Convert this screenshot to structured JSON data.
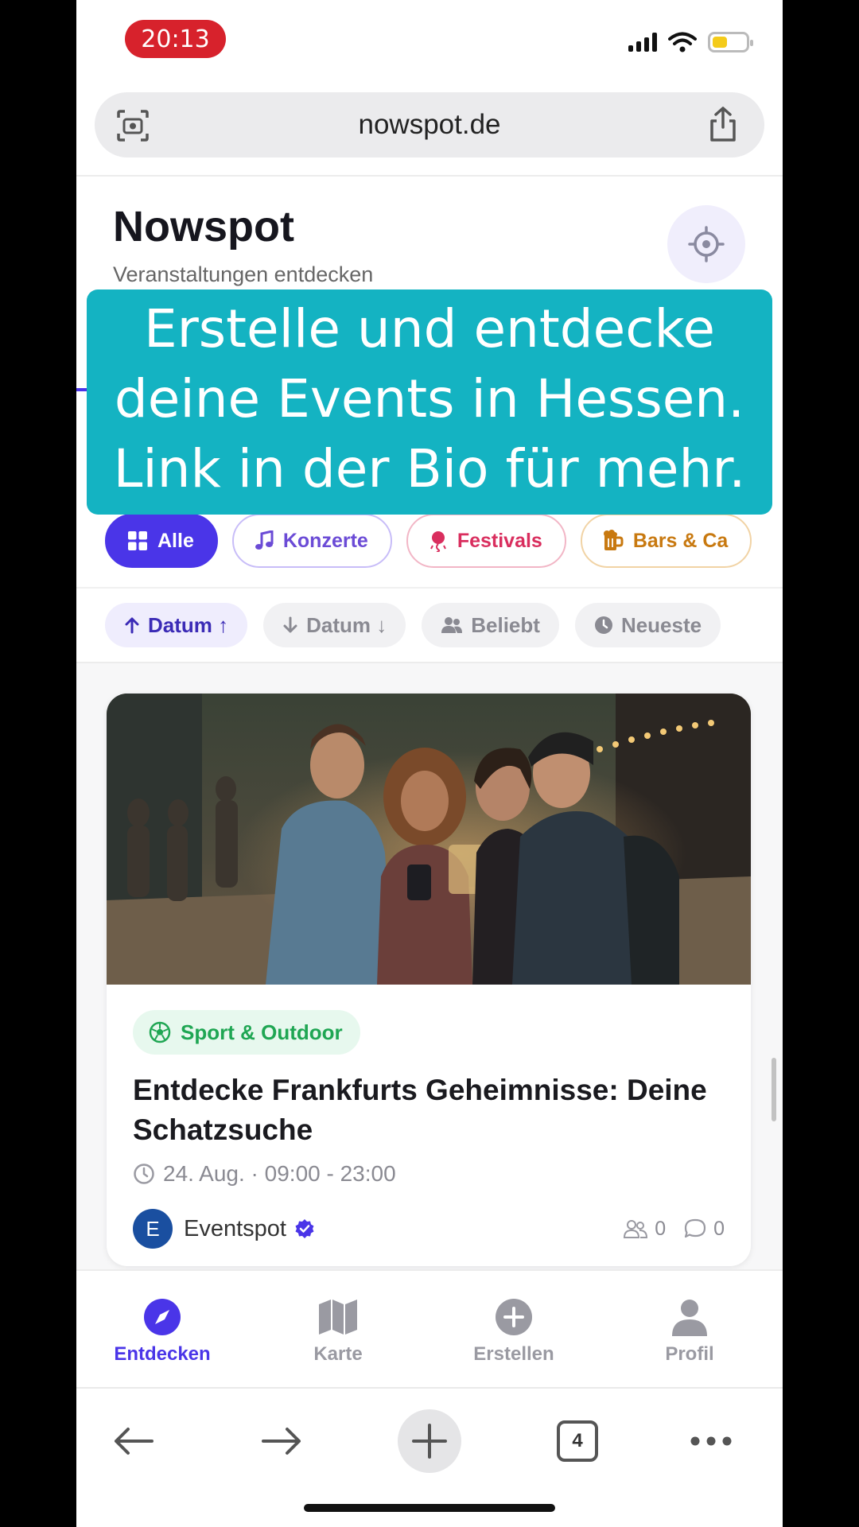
{
  "status_bar": {
    "time": "20:13",
    "time_pill_color": "#d7222c",
    "battery_color": "#f4cb1a"
  },
  "browser": {
    "url": "nowspot.de",
    "tab_count": "4"
  },
  "app": {
    "title": "Nowspot",
    "subtitle": "Veranstaltungen entdecken",
    "accent_color": "#4a35e8"
  },
  "caption": {
    "lines": [
      "Erstelle und entdecke",
      "deine Events in Hessen.",
      "Link in der Bio für mehr."
    ],
    "background": "#14b3c2"
  },
  "categories": [
    {
      "label": "Alle",
      "icon": "grid-icon",
      "active": true
    },
    {
      "label": "Konzerte",
      "icon": "music-note-icon"
    },
    {
      "label": "Festivals",
      "icon": "balloon-icon"
    },
    {
      "label": "Bars & Ca",
      "icon": "beer-mug-icon"
    }
  ],
  "sort": [
    {
      "label": "Datum ↑",
      "icon": "arrow-up-icon",
      "active": true
    },
    {
      "label": "Datum ↓",
      "icon": "arrow-down-icon"
    },
    {
      "label": "Beliebt",
      "icon": "people-icon"
    },
    {
      "label": "Neueste",
      "icon": "clock-icon"
    }
  ],
  "event": {
    "tag": "Sport & Outdoor",
    "tag_icon": "soccer-ball-icon",
    "title": "Entdecke Frankfurts Geheimnisse: Deine Schatzsuche",
    "time": "24. Aug. · 09:00 - 23:00",
    "organizer_initial": "E",
    "organizer": "Eventspot",
    "participants": "0",
    "comments": "0"
  },
  "tabs": [
    {
      "label": "Entdecken",
      "icon": "compass-icon",
      "active": true
    },
    {
      "label": "Karte",
      "icon": "map-icon"
    },
    {
      "label": "Erstellen",
      "icon": "plus-circle-icon"
    },
    {
      "label": "Profil",
      "icon": "person-icon"
    }
  ]
}
